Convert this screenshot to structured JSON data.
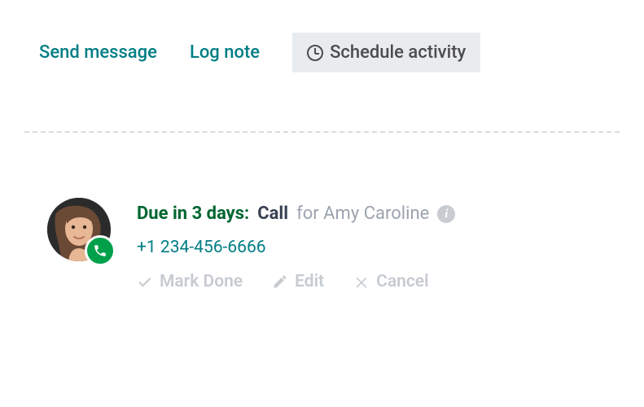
{
  "tabs": {
    "send_message": "Send message",
    "log_note": "Log note",
    "schedule_activity": "Schedule activity"
  },
  "activity": {
    "due_label": "Due in 3 days:",
    "type_label": "Call",
    "for_label": "for Amy Caroline",
    "phone": "+1 234-456-6666"
  },
  "actions": {
    "mark_done": "Mark Done",
    "edit": "Edit",
    "cancel": "Cancel"
  }
}
